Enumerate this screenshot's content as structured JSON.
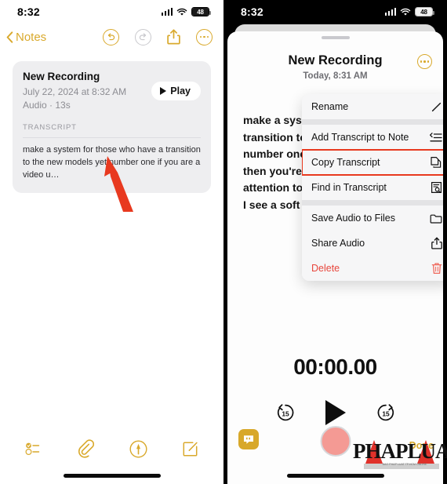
{
  "left": {
    "statusbar": {
      "time": "8:32",
      "battery": "48",
      "signal_icon": "signal-bars-icon",
      "wifi_icon": "wifi-icon",
      "battery_icon": "battery-icon"
    },
    "nav": {
      "back_label": "Notes",
      "back_icon": "chevron-left-icon",
      "undo_icon": "undo-icon",
      "redo_icon": "redo-icon",
      "share_icon": "share-icon",
      "more_icon": "ellipsis-icon"
    },
    "card": {
      "title": "New Recording",
      "date": "July 22, 2024 at 8:32 AM",
      "audio": "Audio · 13s",
      "play_label": "Play",
      "play_icon": "play-triangle-icon",
      "transcript_label": "TRANSCRIPT",
      "transcript_text": "make a system for those who have a transition to the new models yet number one if you are a video u…"
    },
    "toolbar": {
      "checklist_icon": "checklist-icon",
      "attachment_icon": "paperclip-icon",
      "markup_icon": "markup-pen-icon",
      "compose_icon": "compose-icon"
    }
  },
  "right": {
    "statusbar": {
      "time": "8:32",
      "battery": "48",
      "signal_icon": "signal-bars-icon",
      "wifi_icon": "wifi-icon",
      "battery_icon": "battery-icon"
    },
    "sheet": {
      "title": "New Recording",
      "subtitle": "Today, 8:31 AM",
      "more_icon": "ellipsis-icon",
      "grabber_icon": "sheet-grabber"
    },
    "transcript_lines": [
      "make a sys",
      "transition to",
      "number one",
      "then you're",
      "attention to",
      "I see a soft"
    ],
    "menu": {
      "items": [
        {
          "label": "Rename",
          "icon": "pencil-icon",
          "danger": false,
          "highlighted": false,
          "sep_after": true
        },
        {
          "label": "Add Transcript to Note",
          "icon": "text-insert-icon",
          "danger": false,
          "highlighted": false,
          "sep_after": false
        },
        {
          "label": "Copy Transcript",
          "icon": "copy-documents-icon",
          "danger": false,
          "highlighted": true,
          "sep_after": false
        },
        {
          "label": "Find in Transcript",
          "icon": "document-search-icon",
          "danger": false,
          "highlighted": false,
          "sep_after": true
        },
        {
          "label": "Save Audio to Files",
          "icon": "folder-icon",
          "danger": false,
          "highlighted": false,
          "sep_after": false
        },
        {
          "label": "Share Audio",
          "icon": "share-icon",
          "danger": false,
          "highlighted": false,
          "sep_after": false
        },
        {
          "label": "Delete",
          "icon": "trash-icon",
          "danger": true,
          "highlighted": false,
          "sep_after": false
        }
      ],
      "highlight_color": "#e8391f"
    },
    "player": {
      "timer": "00:00.00",
      "skip_back_label": "15",
      "skip_forward_label": "15",
      "skip_back_icon": "skip-back-15-icon",
      "play_icon": "play-triangle-icon",
      "skip_forward_icon": "skip-forward-15-icon"
    },
    "bottom": {
      "chat_icon": "quote-bubble-icon",
      "record_icon": "record-button",
      "done_label": "Done"
    }
  },
  "annotations": {
    "left_arrow": "red-arrow-up-left",
    "right_arrow": "red-arrow-down-right",
    "arrow_color": "#e8391f"
  },
  "watermark": {
    "text": "PHAPLUAT",
    "subtext": "BAO PHAP LUAT TP.HCM ONLINE"
  },
  "theme": {
    "accent_gold": "#d9a92c",
    "danger_red": "#e8463c",
    "record_pink": "#f49a94"
  }
}
